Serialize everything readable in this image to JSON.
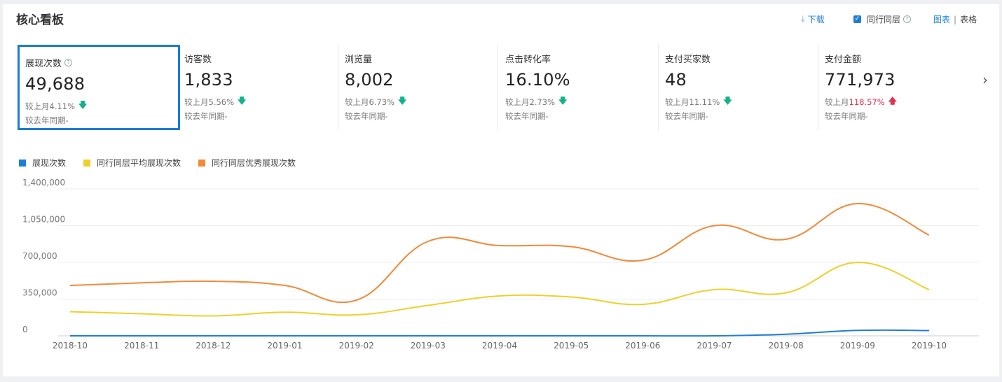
{
  "header": {
    "title": "核心看板",
    "download_label": "下载",
    "peer_label": "同行同层",
    "chart_view_label": "图表",
    "table_view_label": "表格"
  },
  "kpis": [
    {
      "label": "展现次数",
      "value": "49,688",
      "mom_prefix": "较上月",
      "mom_pct": "4.11%",
      "trend": "down",
      "yoy": "较去年同期-"
    },
    {
      "label": "访客数",
      "value": "1,833",
      "mom_prefix": "较上月",
      "mom_pct": "5.56%",
      "trend": "down",
      "yoy": "较去年同期-"
    },
    {
      "label": "浏览量",
      "value": "8,002",
      "mom_prefix": "较上月",
      "mom_pct": "6.73%",
      "trend": "down",
      "yoy": "较去年同期-"
    },
    {
      "label": "点击转化率",
      "value": "16.10%",
      "mom_prefix": "较上月",
      "mom_pct": "2.73%",
      "trend": "down",
      "yoy": "较去年同期-"
    },
    {
      "label": "支付买家数",
      "value": "48",
      "mom_prefix": "较上月",
      "mom_pct": "11.11%",
      "trend": "down",
      "yoy": "较去年同期-"
    },
    {
      "label": "支付金额",
      "value": "771,973",
      "mom_prefix": "较上月",
      "mom_pct": "118.57%",
      "trend": "up",
      "yoy": "较去年同期-"
    }
  ],
  "colors": {
    "series_blue": "#1f7ed6",
    "series_yellow": "#f0cf2c",
    "series_orange": "#f08a3a",
    "trend_down": "#13b28a",
    "trend_up": "#e0334d"
  },
  "chart_data": {
    "type": "line",
    "categories": [
      "2018-10",
      "2018-11",
      "2018-12",
      "2019-01",
      "2019-02",
      "2019-03",
      "2019-04",
      "2019-05",
      "2019-06",
      "2019-07",
      "2019-08",
      "2019-09",
      "2019-10"
    ],
    "ylim": [
      0,
      1400000
    ],
    "yticks": [
      "0",
      "350,000",
      "700,000",
      "1,050,000",
      "1,400,000"
    ],
    "ytick_values": [
      0,
      350000,
      700000,
      1050000,
      1400000
    ],
    "grid": true,
    "legend_position": "top-left",
    "series": [
      {
        "name": "展现次数",
        "color": "#1f7ed6",
        "values": [
          0,
          0,
          0,
          0,
          0,
          0,
          0,
          0,
          0,
          0,
          15000,
          52000,
          50000
        ]
      },
      {
        "name": "同行同层平均展现次数",
        "color": "#f0cf2c",
        "values": [
          230000,
          210000,
          190000,
          225000,
          200000,
          290000,
          380000,
          370000,
          300000,
          440000,
          410000,
          700000,
          440000
        ]
      },
      {
        "name": "同行同层优秀展现次数",
        "color": "#f08a3a",
        "values": [
          480000,
          505000,
          520000,
          480000,
          340000,
          900000,
          860000,
          850000,
          720000,
          1050000,
          920000,
          1260000,
          960000
        ]
      }
    ]
  }
}
